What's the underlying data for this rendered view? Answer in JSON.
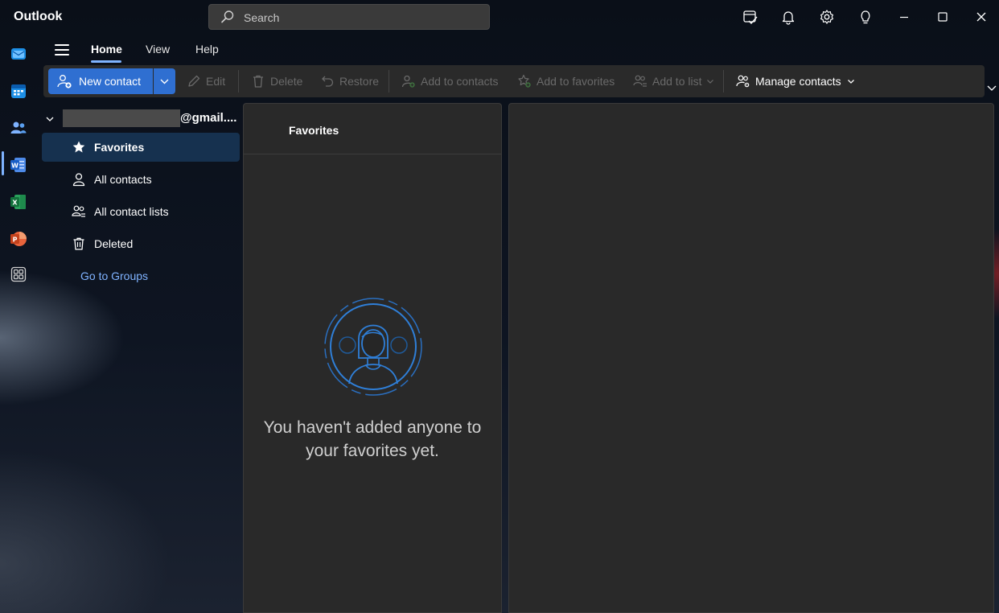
{
  "app": {
    "title": "Outlook"
  },
  "search": {
    "placeholder": "Search"
  },
  "titlebar_icons": [
    "my-day-icon",
    "bell-icon",
    "gear-icon",
    "lightbulb-icon",
    "minimize-icon",
    "maximize-icon",
    "close-icon"
  ],
  "rail": {
    "items": [
      "mail-icon",
      "calendar-icon",
      "people-icon",
      "word-icon",
      "excel-icon",
      "powerpoint-icon",
      "more-apps-icon"
    ],
    "active": "people-icon"
  },
  "tabs": [
    {
      "label": "Home",
      "active": true
    },
    {
      "label": "View",
      "active": false
    },
    {
      "label": "Help",
      "active": false
    }
  ],
  "ribbon": {
    "new_contact": "New contact",
    "edit": "Edit",
    "delete": "Delete",
    "restore": "Restore",
    "add_to_contacts": "Add to contacts",
    "add_to_favorites": "Add to favorites",
    "add_to_list": "Add to list",
    "manage_contacts": "Manage contacts"
  },
  "account": {
    "email_suffix": "@gmail...."
  },
  "folders": [
    {
      "label": "Favorites",
      "icon": "star-icon",
      "selected": true
    },
    {
      "label": "All contacts",
      "icon": "person-icon",
      "selected": false
    },
    {
      "label": "All contact lists",
      "icon": "people-list-icon",
      "selected": false
    },
    {
      "label": "Deleted",
      "icon": "trash-icon",
      "selected": false
    }
  ],
  "groups_link": "Go to Groups",
  "list": {
    "header": "Favorites",
    "empty_message": "You haven't added anyone to your favorites yet."
  },
  "colors": {
    "accent": "#2f6fd1",
    "link": "#7fb3ff",
    "selected_bg": "#16314f",
    "pane_bg": "#292929"
  }
}
